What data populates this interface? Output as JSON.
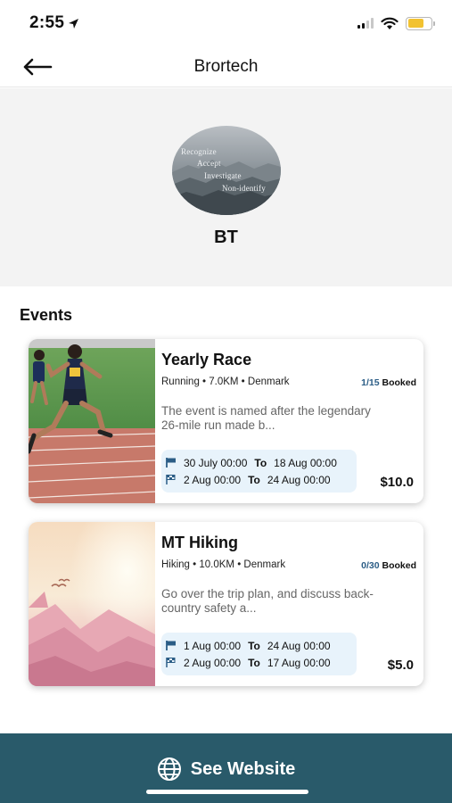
{
  "status_bar": {
    "time": "2:55",
    "battery_color": "#f2c230"
  },
  "header": {
    "title": "Brortech"
  },
  "profile": {
    "initials": "BT",
    "avatar_lines": [
      "Recognize",
      "Accept",
      "Investigate",
      "Non-identify"
    ]
  },
  "events_section": {
    "title": "Events"
  },
  "events": [
    {
      "title": "Yearly Race",
      "meta": "Running • 7.0KM • Denmark",
      "booked_count": "1/15",
      "booked_label": "Booked",
      "description": "The event is named after the legendary 26-mile run made b...",
      "start_row": {
        "from": "30 July 00:00",
        "to_label": "To",
        "to": "18 Aug 00:00"
      },
      "end_row": {
        "from": "2 Aug 00:00",
        "to_label": "To",
        "to": "24 Aug 00:00"
      },
      "price": "$10.0",
      "image": "running-track-photo"
    },
    {
      "title": "MT Hiking",
      "meta": "Hiking • 10.0KM • Denmark",
      "booked_count": "0/30",
      "booked_label": "Booked",
      "description": "Go over the trip plan, and discuss back-country safety a...",
      "start_row": {
        "from": "1 Aug 00:00",
        "to_label": "To",
        "to": "24 Aug 00:00"
      },
      "end_row": {
        "from": "2 Aug 00:00",
        "to_label": "To",
        "to": "17 Aug 00:00"
      },
      "price": "$5.0",
      "image": "sunset-mountain-photo"
    }
  ],
  "bottom_bar": {
    "button_label": "See Website",
    "icon": "globe-icon",
    "background": "#295a6a"
  },
  "colors": {
    "accent": "#2b5d86",
    "date_box": "#e8f3fb"
  }
}
